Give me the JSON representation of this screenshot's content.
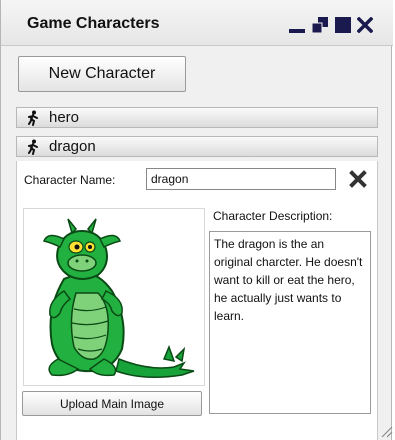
{
  "window": {
    "title": "Game Characters",
    "controls": [
      "minimize-icon",
      "restore-icon",
      "maximize-icon",
      "close-icon"
    ]
  },
  "toolbar": {
    "new_character_label": "New Character"
  },
  "characters": [
    {
      "name": "hero",
      "icon": "walking-figure-icon"
    },
    {
      "name": "dragon",
      "icon": "walking-figure-icon"
    }
  ],
  "editor": {
    "name_label": "Character Name:",
    "name_value": "dragon",
    "description_label": "Character Description:",
    "description_value": "The dragon is the an original charcter. He doesn't want to kill or eat the hero, he actually just wants to learn.",
    "upload_label": "Upload Main Image",
    "image": "green-dragon-picture"
  }
}
